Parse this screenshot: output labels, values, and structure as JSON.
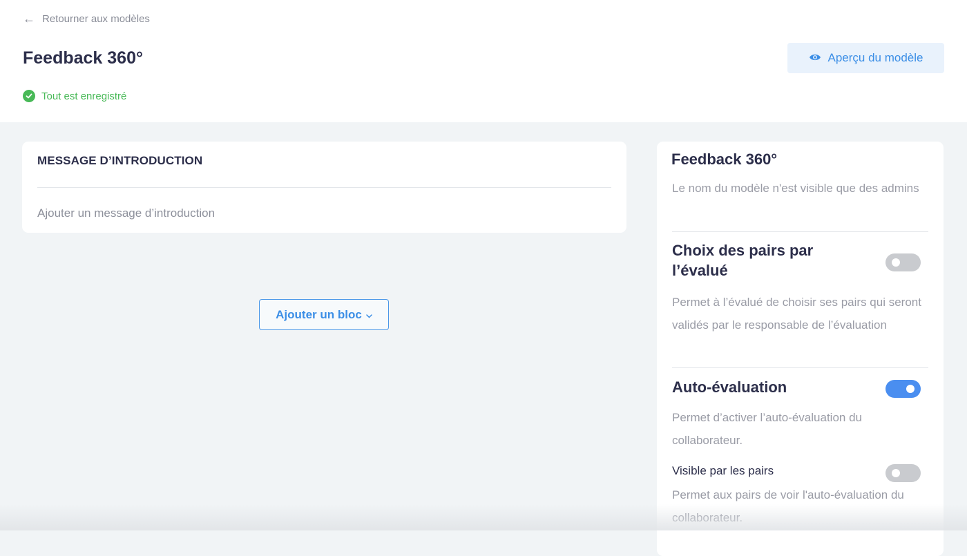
{
  "header": {
    "back_label": "Retourner aux modèles",
    "title": "Feedback 360°",
    "status": "Tout est enregistré",
    "preview_label": "Aperçu du modèle"
  },
  "intro": {
    "title": "MESSAGE D’INTRODUCTION",
    "placeholder": "Ajouter un message d’introduction"
  },
  "add_block": {
    "label": "Ajouter un bloc"
  },
  "panel": {
    "title": "Feedback 360°",
    "subtitle": "Le nom du modèle n'est visible que des admins",
    "settings": [
      {
        "title": "Choix des pairs par l’évalué",
        "description": "Permet à l’évalué de choisir ses pairs qui seront validés par le responsable de l’évaluation",
        "enabled": false
      },
      {
        "title": "Auto-évaluation",
        "description": "Permet d’activer l’auto-évaluation du collaborateur.",
        "enabled": true
      },
      {
        "title": "Visible par les pairs",
        "description": "Permet aux pairs de voir l'auto-évaluation du collaborateur.",
        "enabled": false
      }
    ]
  },
  "colors": {
    "accent": "#3b8ee6",
    "success": "#48b957",
    "toggle_on": "#4a8ef0",
    "toggle_off": "#c9cbcf",
    "title_text": "#2c2e4a",
    "muted_text": "#9a9ca6"
  },
  "icons": {
    "back": "arrow-left-icon",
    "status": "check-circle-icon",
    "preview": "eye-icon",
    "dropdown": "chevron-down-icon"
  }
}
